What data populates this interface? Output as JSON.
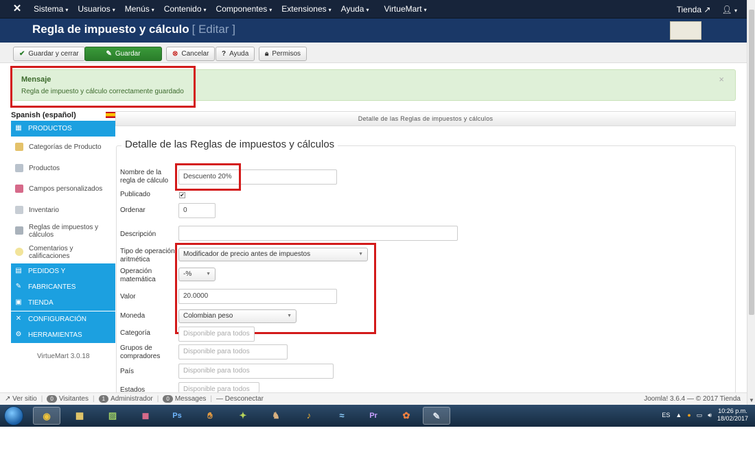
{
  "topnav": {
    "menu": [
      "Sistema",
      "Usuarios",
      "Menús",
      "Contenido",
      "Componentes",
      "Extensiones",
      "Ayuda",
      "VirtueMart"
    ],
    "store_label": "Tienda"
  },
  "header": {
    "title": "Regla de impuesto y cálculo",
    "subtitle": "[ Editar ]"
  },
  "toolbar": {
    "save_close": "Guardar y cerrar",
    "save": "Guardar",
    "cancel": "Cancelar",
    "help": "Ayuda",
    "permissions": "Permisos"
  },
  "message": {
    "heading": "Mensaje",
    "text": "Regla de impuesto y cálculo correctamente guardado",
    "close": "×"
  },
  "sidebar": {
    "language": "Spanish (español)",
    "products_section": "PRODUCTOS",
    "items": [
      "Categorías de Producto",
      "Productos",
      "Campos personalizados",
      "Inventario",
      "Reglas de impuestos y cálculos",
      "Comentarios y calificaciones"
    ],
    "sections": [
      "PEDIDOS Y",
      "FABRICANTES",
      "TIENDA",
      "CONFIGURACIÓN",
      "HERRAMIENTAS"
    ],
    "version": "VirtueMart 3.0.18"
  },
  "panel": {
    "header": "Detalle de las Reglas de impuestos y cálculos",
    "legend": "Detalle de las Reglas de impuestos y cálculos"
  },
  "form": {
    "name_label": "Nombre de la regla de cálculo",
    "name_value": "Descuento 20%",
    "published_label": "Publicado",
    "order_label": "Ordenar",
    "order_value": "0",
    "description_label": "Descripción",
    "description_value": "",
    "operation_type_label": "Tipo de operación aritmética",
    "operation_type_value": "Modificador de precio antes de impuestos",
    "math_op_label": "Operación matemática",
    "math_op_value": "-%",
    "value_label": "Valor",
    "value_value": "20.0000",
    "currency_label": "Moneda",
    "currency_value": "Colombian peso",
    "category_label": "Categoría",
    "category_placeholder": "Disponible para todos",
    "buyer_groups_label": "Grupos de compradores",
    "buyer_groups_placeholder": "Disponible para todos",
    "country_label": "País",
    "country_placeholder": "Disponible para todos",
    "states_label": "Estados",
    "states_placeholder": "Disponible para todos"
  },
  "statusbar": {
    "view_site": "Ver sitio",
    "visitors_count": "0",
    "visitors_label": "Visitantes",
    "admin_count": "1",
    "admin_label": "Administrador",
    "messages_count": "0",
    "messages_label": "Messages",
    "logout": "Desconectar",
    "footer": "Joomla! 3.6.4 — © 2017 Tienda"
  },
  "taskbar": {
    "lang": "ES",
    "time": "10:26 p.m.",
    "date": "18/02/2017",
    "apps": [
      "chrome-icon",
      "file-manager-icon",
      "image-editor-icon",
      "media-icon",
      "photoshop-icon",
      "hand-icon",
      "tool-icon",
      "game-icon",
      "music-icon",
      "shark-icon",
      "premiere-icon",
      "tool2-icon",
      "paint-icon"
    ]
  },
  "colors": {
    "nav_bg": "#17243a",
    "header_bg": "#1a3867",
    "sidebar_accent": "#1ca0e0",
    "success_bg": "#dff0d8",
    "highlight_red": "#d31a1a",
    "save_green": "#2f8a2f"
  }
}
